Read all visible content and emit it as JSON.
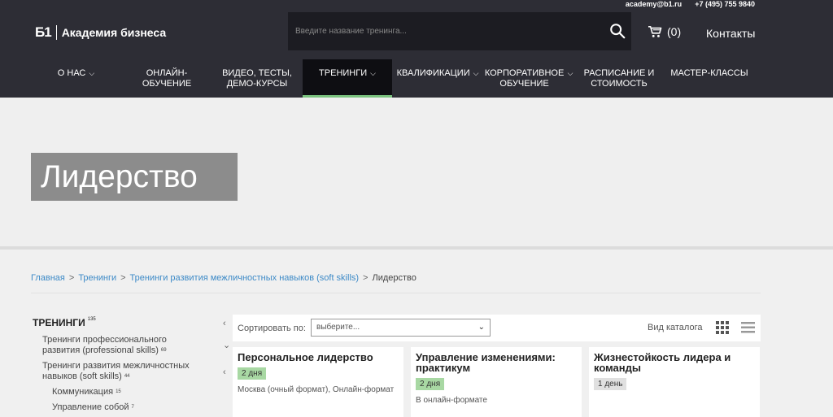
{
  "top": {
    "email": "academy@b1.ru",
    "phone": "+7 (495) 755 9840"
  },
  "logo": {
    "mark": "Б1",
    "text": "Академия бизнеса"
  },
  "search": {
    "placeholder": "Введите название тренинга..."
  },
  "cart": {
    "count": "(0)"
  },
  "contacts": "Контакты",
  "nav": [
    {
      "label": "О НАС"
    },
    {
      "label": "ОНЛАЙН-ОБУЧЕНИЕ"
    },
    {
      "label": "ВИДЕО, ТЕСТЫ, ДЕМО-КУРСЫ"
    },
    {
      "label": "ТРЕНИНГИ"
    },
    {
      "label": "КВАЛИФИКАЦИИ"
    },
    {
      "label": "КОРПОРАТИВНОЕ ОБУЧЕНИЕ"
    },
    {
      "label": "РАСПИСАНИЕ И СТОИМОСТЬ"
    },
    {
      "label": "МАСТЕР-КЛАССЫ"
    }
  ],
  "hero": {
    "title": "Лидерство"
  },
  "breadcrumb": {
    "items": [
      "Главная",
      "Тренинги",
      "Тренинги развития межличностных навыков (soft skills)"
    ],
    "separator": ">",
    "current": "Лидерство"
  },
  "sidebar": {
    "heading": "ТРЕНИНГИ",
    "heading_count": "135",
    "items": [
      {
        "label": "Тренинги профессионального развития (professional skills)",
        "count": "69"
      },
      {
        "label": "Тренинги развития межличностных навыков (soft skills)",
        "count": "44"
      },
      {
        "label": "Коммуникация",
        "count": "15"
      },
      {
        "label": "Управление собой",
        "count": "7"
      }
    ]
  },
  "toolbar": {
    "sort_label": "Сортировать по:",
    "sort_value": "выберите...",
    "view_label": "Вид каталога"
  },
  "cards": [
    {
      "title": "Персональное лидерство",
      "duration": "2 дня",
      "format": "Москва (очный формат), Онлайн-формат"
    },
    {
      "title": "Управление изменениями: практикум",
      "duration": "2 дня",
      "format": "В онлайн-формате"
    },
    {
      "title": "Жизнестойкость лидера и команды",
      "duration": "1 день",
      "format": ""
    }
  ],
  "colors": {
    "header_bg": "#2d2d35",
    "accent_green": "#7ac27e",
    "link_blue": "#3d8ac7"
  }
}
